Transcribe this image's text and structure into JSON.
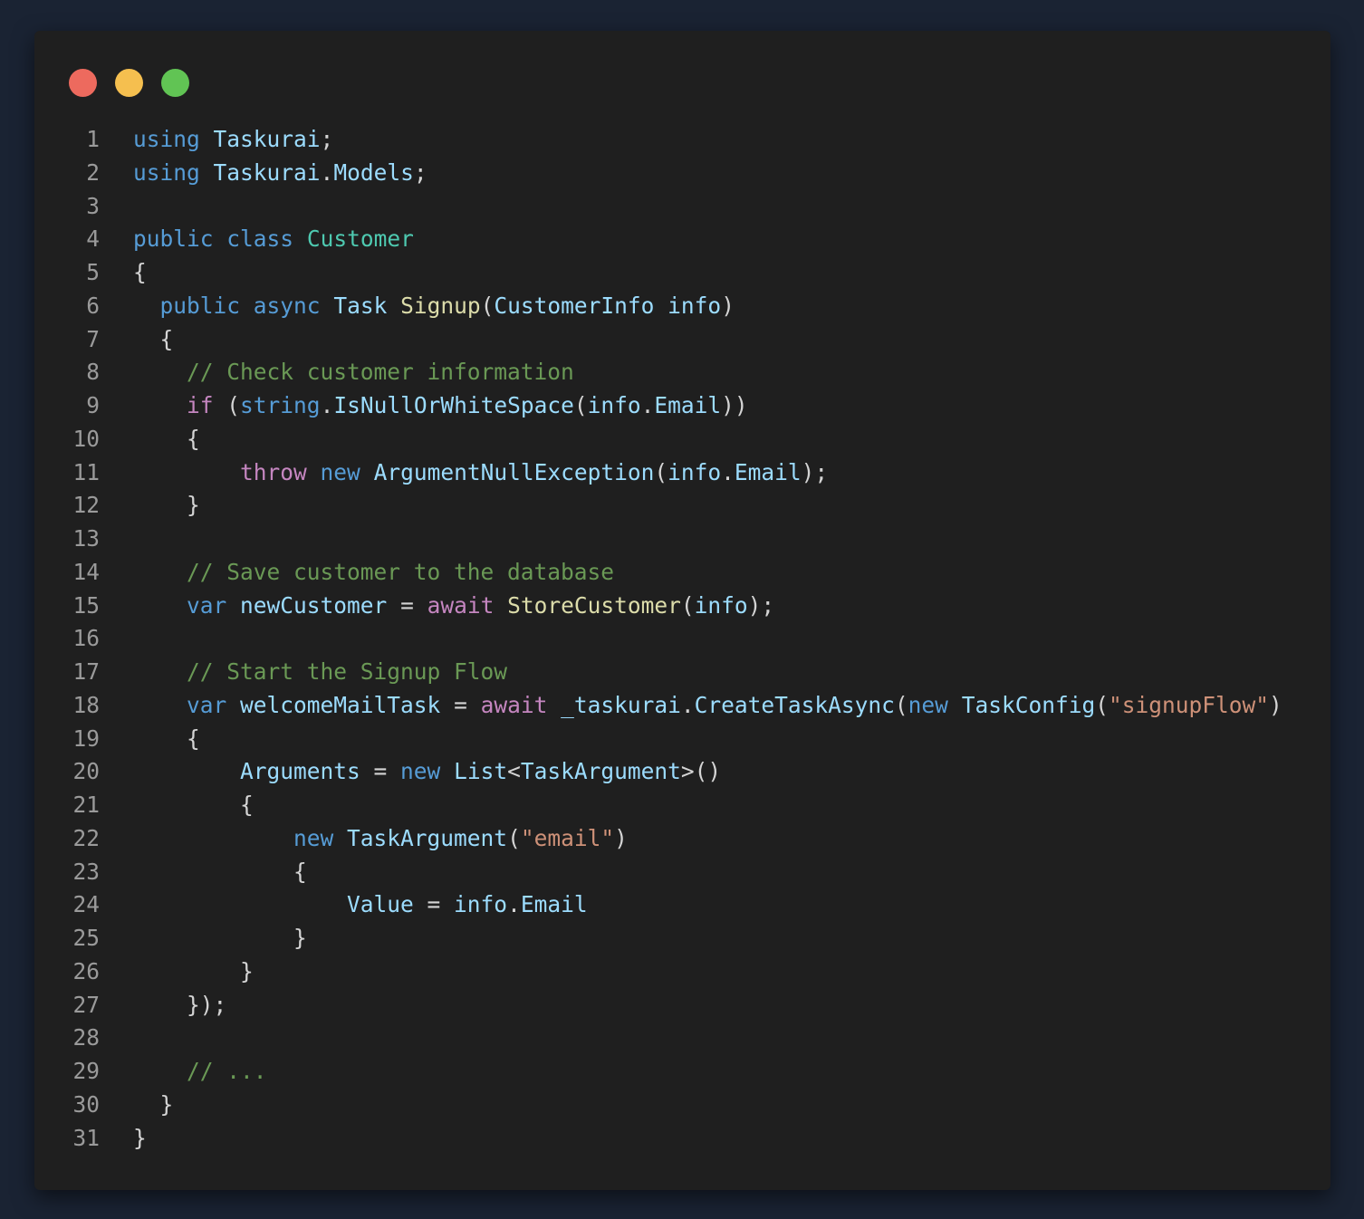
{
  "window": {
    "buttons": [
      {
        "name": "close",
        "color": "#ed6a5e"
      },
      {
        "name": "minimize",
        "color": "#f5bf4f"
      },
      {
        "name": "maximize",
        "color": "#61c454"
      }
    ]
  },
  "code": {
    "lines": [
      {
        "n": "1",
        "tokens": [
          {
            "t": "using",
            "c": "keyword"
          },
          {
            "t": " ",
            "c": "punct"
          },
          {
            "t": "Taskurai",
            "c": "ident"
          },
          {
            "t": ";",
            "c": "punct"
          }
        ]
      },
      {
        "n": "2",
        "tokens": [
          {
            "t": "using",
            "c": "keyword"
          },
          {
            "t": " ",
            "c": "punct"
          },
          {
            "t": "Taskurai",
            "c": "ident"
          },
          {
            "t": ".",
            "c": "punct"
          },
          {
            "t": "Models",
            "c": "ident"
          },
          {
            "t": ";",
            "c": "punct"
          }
        ]
      },
      {
        "n": "3",
        "tokens": []
      },
      {
        "n": "4",
        "tokens": [
          {
            "t": "public",
            "c": "keyword"
          },
          {
            "t": " ",
            "c": "punct"
          },
          {
            "t": "class",
            "c": "keyword"
          },
          {
            "t": " ",
            "c": "punct"
          },
          {
            "t": "Customer",
            "c": "type"
          }
        ]
      },
      {
        "n": "5",
        "tokens": [
          {
            "t": "{",
            "c": "punct"
          }
        ]
      },
      {
        "n": "6",
        "tokens": [
          {
            "t": "  ",
            "c": "punct"
          },
          {
            "t": "public",
            "c": "keyword"
          },
          {
            "t": " ",
            "c": "punct"
          },
          {
            "t": "async",
            "c": "keyword"
          },
          {
            "t": " ",
            "c": "punct"
          },
          {
            "t": "Task",
            "c": "ident"
          },
          {
            "t": " ",
            "c": "punct"
          },
          {
            "t": "Signup",
            "c": "func"
          },
          {
            "t": "(",
            "c": "punct"
          },
          {
            "t": "CustomerInfo",
            "c": "ident"
          },
          {
            "t": " ",
            "c": "punct"
          },
          {
            "t": "info",
            "c": "ident"
          },
          {
            "t": ")",
            "c": "punct"
          }
        ]
      },
      {
        "n": "7",
        "tokens": [
          {
            "t": "  {",
            "c": "punct"
          }
        ]
      },
      {
        "n": "8",
        "tokens": [
          {
            "t": "    ",
            "c": "punct"
          },
          {
            "t": "// Check customer information",
            "c": "comment"
          }
        ]
      },
      {
        "n": "9",
        "tokens": [
          {
            "t": "    ",
            "c": "punct"
          },
          {
            "t": "if",
            "c": "control"
          },
          {
            "t": " (",
            "c": "punct"
          },
          {
            "t": "string",
            "c": "keyword"
          },
          {
            "t": ".",
            "c": "punct"
          },
          {
            "t": "IsNullOrWhiteSpace",
            "c": "ident"
          },
          {
            "t": "(",
            "c": "punct"
          },
          {
            "t": "info",
            "c": "ident"
          },
          {
            "t": ".",
            "c": "punct"
          },
          {
            "t": "Email",
            "c": "ident"
          },
          {
            "t": "))",
            "c": "punct"
          }
        ]
      },
      {
        "n": "10",
        "tokens": [
          {
            "t": "    {",
            "c": "punct"
          }
        ]
      },
      {
        "n": "11",
        "tokens": [
          {
            "t": "        ",
            "c": "punct"
          },
          {
            "t": "throw",
            "c": "control"
          },
          {
            "t": " ",
            "c": "punct"
          },
          {
            "t": "new",
            "c": "keyword"
          },
          {
            "t": " ",
            "c": "punct"
          },
          {
            "t": "ArgumentNullException",
            "c": "ident"
          },
          {
            "t": "(",
            "c": "punct"
          },
          {
            "t": "info",
            "c": "ident"
          },
          {
            "t": ".",
            "c": "punct"
          },
          {
            "t": "Email",
            "c": "ident"
          },
          {
            "t": ");",
            "c": "punct"
          }
        ]
      },
      {
        "n": "12",
        "tokens": [
          {
            "t": "    }",
            "c": "punct"
          }
        ]
      },
      {
        "n": "13",
        "tokens": []
      },
      {
        "n": "14",
        "tokens": [
          {
            "t": "    ",
            "c": "punct"
          },
          {
            "t": "// Save customer to the database",
            "c": "comment"
          }
        ]
      },
      {
        "n": "15",
        "tokens": [
          {
            "t": "    ",
            "c": "punct"
          },
          {
            "t": "var",
            "c": "keyword"
          },
          {
            "t": " ",
            "c": "punct"
          },
          {
            "t": "newCustomer",
            "c": "ident"
          },
          {
            "t": " = ",
            "c": "punct"
          },
          {
            "t": "await",
            "c": "control"
          },
          {
            "t": " ",
            "c": "punct"
          },
          {
            "t": "StoreCustomer",
            "c": "func"
          },
          {
            "t": "(",
            "c": "punct"
          },
          {
            "t": "info",
            "c": "ident"
          },
          {
            "t": ");",
            "c": "punct"
          }
        ]
      },
      {
        "n": "16",
        "tokens": []
      },
      {
        "n": "17",
        "tokens": [
          {
            "t": "    ",
            "c": "punct"
          },
          {
            "t": "// Start the Signup Flow",
            "c": "comment"
          }
        ]
      },
      {
        "n": "18",
        "tokens": [
          {
            "t": "    ",
            "c": "punct"
          },
          {
            "t": "var",
            "c": "keyword"
          },
          {
            "t": " ",
            "c": "punct"
          },
          {
            "t": "welcomeMailTask",
            "c": "ident"
          },
          {
            "t": " = ",
            "c": "punct"
          },
          {
            "t": "await",
            "c": "control"
          },
          {
            "t": " ",
            "c": "punct"
          },
          {
            "t": "_taskurai",
            "c": "ident"
          },
          {
            "t": ".",
            "c": "punct"
          },
          {
            "t": "CreateTaskAsync",
            "c": "ident"
          },
          {
            "t": "(",
            "c": "punct"
          },
          {
            "t": "new",
            "c": "keyword"
          },
          {
            "t": " ",
            "c": "punct"
          },
          {
            "t": "TaskConfig",
            "c": "ident"
          },
          {
            "t": "(",
            "c": "punct"
          },
          {
            "t": "\"signupFlow\"",
            "c": "string"
          },
          {
            "t": ")",
            "c": "punct"
          }
        ]
      },
      {
        "n": "19",
        "tokens": [
          {
            "t": "    {",
            "c": "punct"
          }
        ]
      },
      {
        "n": "20",
        "tokens": [
          {
            "t": "        ",
            "c": "punct"
          },
          {
            "t": "Arguments",
            "c": "ident"
          },
          {
            "t": " = ",
            "c": "punct"
          },
          {
            "t": "new",
            "c": "keyword"
          },
          {
            "t": " ",
            "c": "punct"
          },
          {
            "t": "List",
            "c": "ident"
          },
          {
            "t": "<",
            "c": "punct"
          },
          {
            "t": "TaskArgument",
            "c": "ident"
          },
          {
            "t": ">()",
            "c": "punct"
          }
        ]
      },
      {
        "n": "21",
        "tokens": [
          {
            "t": "        {",
            "c": "punct"
          }
        ]
      },
      {
        "n": "22",
        "tokens": [
          {
            "t": "            ",
            "c": "punct"
          },
          {
            "t": "new",
            "c": "keyword"
          },
          {
            "t": " ",
            "c": "punct"
          },
          {
            "t": "TaskArgument",
            "c": "ident"
          },
          {
            "t": "(",
            "c": "punct"
          },
          {
            "t": "\"email\"",
            "c": "string"
          },
          {
            "t": ")",
            "c": "punct"
          }
        ]
      },
      {
        "n": "23",
        "tokens": [
          {
            "t": "            {",
            "c": "punct"
          }
        ]
      },
      {
        "n": "24",
        "tokens": [
          {
            "t": "                ",
            "c": "punct"
          },
          {
            "t": "Value",
            "c": "ident"
          },
          {
            "t": " = ",
            "c": "punct"
          },
          {
            "t": "info",
            "c": "ident"
          },
          {
            "t": ".",
            "c": "punct"
          },
          {
            "t": "Email",
            "c": "ident"
          }
        ]
      },
      {
        "n": "25",
        "tokens": [
          {
            "t": "            }",
            "c": "punct"
          }
        ]
      },
      {
        "n": "26",
        "tokens": [
          {
            "t": "        }",
            "c": "punct"
          }
        ]
      },
      {
        "n": "27",
        "tokens": [
          {
            "t": "    });",
            "c": "punct"
          }
        ]
      },
      {
        "n": "28",
        "tokens": []
      },
      {
        "n": "29",
        "tokens": [
          {
            "t": "    ",
            "c": "punct"
          },
          {
            "t": "// ...",
            "c": "comment"
          }
        ]
      },
      {
        "n": "30",
        "tokens": [
          {
            "t": "  }",
            "c": "punct"
          }
        ]
      },
      {
        "n": "31",
        "tokens": [
          {
            "t": "}",
            "c": "punct"
          }
        ]
      }
    ]
  }
}
